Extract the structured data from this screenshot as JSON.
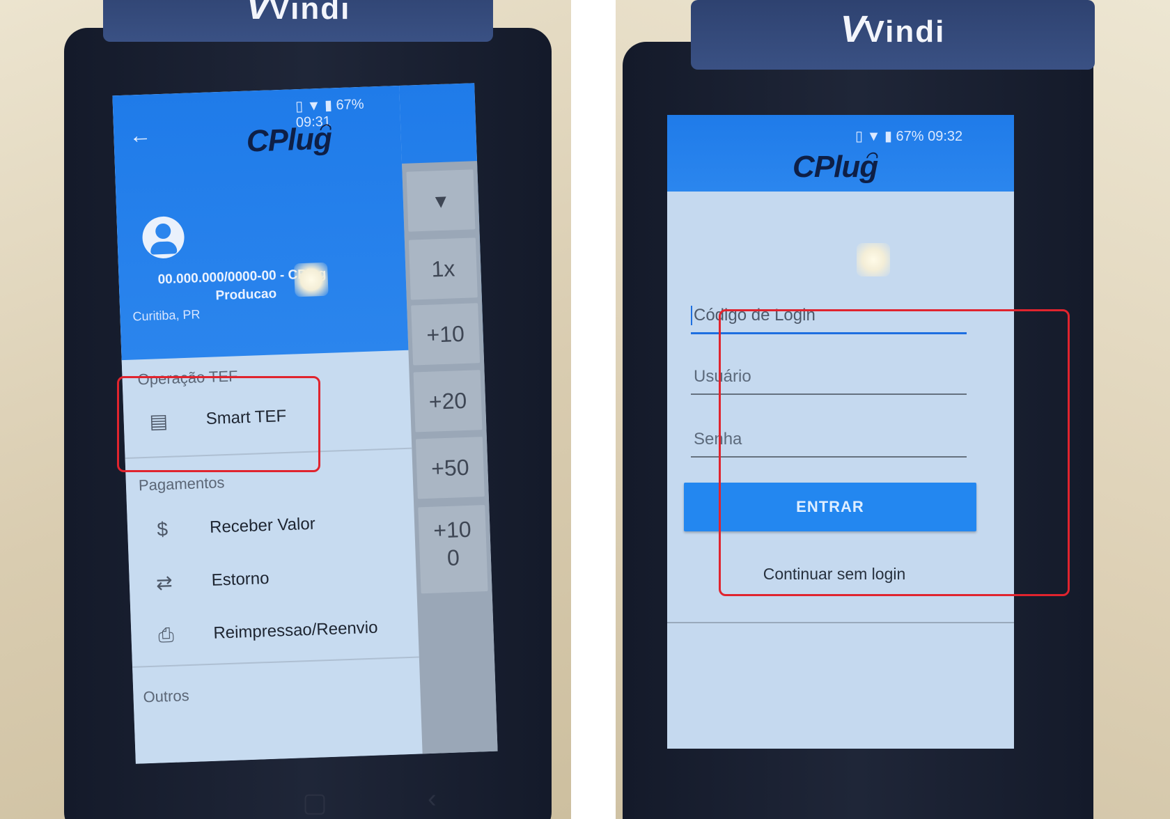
{
  "left_photo": {
    "brand": {
      "mark": "V",
      "word": "Vindi"
    },
    "status_bar": {
      "battery": "67%",
      "time": "09:31"
    },
    "app_logo": "CPlug",
    "account": {
      "id_line": "00.000.000/0000-00 - CPlug",
      "environment": "Producao",
      "city": "Curitiba, PR"
    },
    "background_values": [
      "1x",
      "+10",
      "+20",
      "+50",
      "+10",
      "0"
    ],
    "menu": {
      "section_tef": "Operação TEF",
      "smart_tef": "Smart TEF",
      "section_payments": "Pagamentos",
      "items": [
        {
          "icon": "dollar-icon",
          "label": "Receber Valor"
        },
        {
          "icon": "swap-arrows-icon",
          "label": "Estorno"
        },
        {
          "icon": "printer-icon",
          "label": "Reimpressao/Reenvio"
        }
      ],
      "section_others": "Outros"
    },
    "highlight_color": "#e0242e"
  },
  "right_photo": {
    "brand": {
      "mark": "V",
      "word": "Vindi"
    },
    "status_bar": {
      "battery": "67%",
      "time": "09:32"
    },
    "app_logo": "CPlug",
    "login": {
      "code_placeholder": "Código de Login",
      "user_placeholder": "Usuário",
      "password_placeholder": "Senha",
      "submit_label": "ENTRAR",
      "skip_link": "Continuar sem login"
    },
    "accent_color": "#2387f0"
  }
}
